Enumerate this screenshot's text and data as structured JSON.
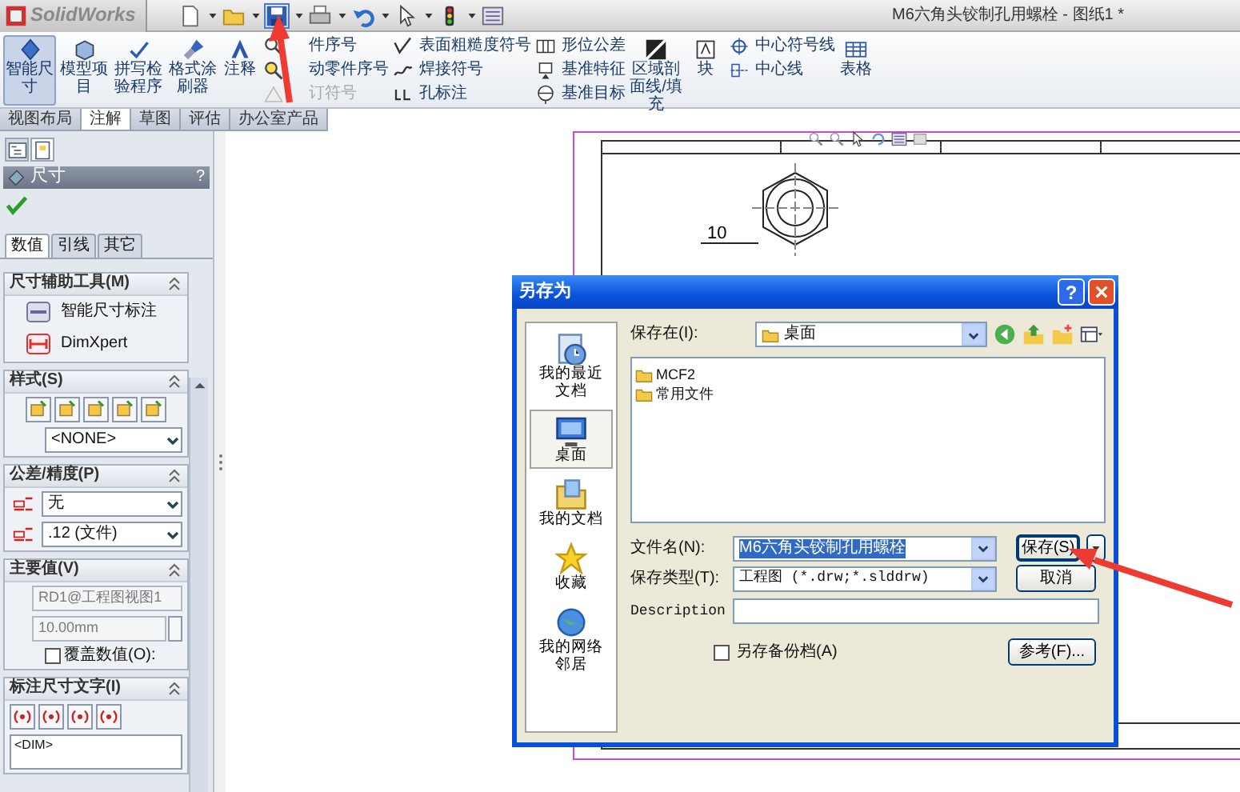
{
  "app": {
    "logo": "SolidWorks",
    "title": "M6六角头铰制孔用螺栓 - 图纸1 *"
  },
  "ribbon": [
    {
      "kind": "large",
      "label": "智能尺寸",
      "selected": true
    },
    {
      "kind": "large",
      "label": "模型项目",
      "selected": false
    },
    {
      "kind": "large",
      "label": "拼写检验程序",
      "selected": false
    },
    {
      "kind": "large",
      "label": "格式涂刷器",
      "selected": false
    },
    {
      "kind": "large",
      "label": "注释",
      "selected": false
    },
    {
      "kind": "stack",
      "items": [
        {
          "label": "件序号",
          "disabled": false
        },
        {
          "label": "动零件序号",
          "disabled": false
        },
        {
          "label": "订符号",
          "disabled": true
        }
      ]
    },
    {
      "kind": "stack",
      "items": [
        {
          "label": "表面粗糙度符号",
          "disabled": false
        },
        {
          "label": "焊接符号",
          "disabled": false
        },
        {
          "label": "孔标注",
          "disabled": false
        }
      ]
    },
    {
      "kind": "stack",
      "items": [
        {
          "label": "形位公差",
          "disabled": false
        },
        {
          "label": "基准特征",
          "disabled": false
        },
        {
          "label": "基准目标",
          "disabled": false
        }
      ]
    },
    {
      "kind": "large",
      "label": "区域剖面线/填充",
      "selected": false
    },
    {
      "kind": "large",
      "label": "块",
      "selected": false
    },
    {
      "kind": "stack",
      "items": [
        {
          "label": "中心符号线",
          "disabled": false
        },
        {
          "label": "中心线",
          "disabled": false
        }
      ]
    },
    {
      "kind": "large",
      "label": "表格",
      "selected": false
    }
  ],
  "command_tabs": [
    {
      "label": "视图布局",
      "selected": false
    },
    {
      "label": "注解",
      "selected": true
    },
    {
      "label": "草图",
      "selected": false
    },
    {
      "label": "评估",
      "selected": false
    },
    {
      "label": "办公室产品",
      "selected": false
    }
  ],
  "property_manager": {
    "tabs": [
      {
        "selected": false
      },
      {
        "selected": true
      }
    ],
    "title": "尺寸",
    "help": "?",
    "sub_tabs": [
      {
        "label": "数值",
        "selected": true
      },
      {
        "label": "引线",
        "selected": false
      },
      {
        "label": "其它",
        "selected": false
      }
    ],
    "sections": [
      {
        "title": "尺寸辅助工具(M)",
        "items": [
          {
            "kind": "tool",
            "label": "智能尺寸标注"
          },
          {
            "kind": "tool",
            "label": "DimXpert"
          }
        ]
      },
      {
        "title": "样式(S)",
        "items": [
          {
            "kind": "style_buttons"
          },
          {
            "kind": "select",
            "value": "<NONE>"
          }
        ]
      },
      {
        "title": "公差/精度(P)",
        "items": [
          {
            "kind": "select_icon",
            "value": "无"
          },
          {
            "kind": "select_icon",
            "value": ".12 (文件)"
          }
        ]
      },
      {
        "title": "主要值(V)",
        "items": [
          {
            "kind": "input",
            "value": "RD1@工程图视图1",
            "disabled": true
          },
          {
            "kind": "spinner",
            "value": "10.00mm",
            "disabled": true
          },
          {
            "kind": "checkbox",
            "label": "覆盖数值(O):",
            "checked": false
          }
        ]
      },
      {
        "title": "标注尺寸文字(I)",
        "items": [
          {
            "kind": "text_buttons"
          },
          {
            "kind": "textarea",
            "value": "<DIM>"
          }
        ]
      }
    ]
  },
  "drawing": {
    "dimension": "10"
  },
  "save_dialog": {
    "title": "另存为",
    "help": "?",
    "places": [
      {
        "label": "我的最近文档",
        "selected": false
      },
      {
        "label": "桌面",
        "selected": true
      },
      {
        "label": "我的文档",
        "selected": false
      },
      {
        "label": "收藏",
        "selected": false
      },
      {
        "label": "我的网络邻居",
        "selected": false
      }
    ],
    "save_in": {
      "label": "保存在(I):",
      "value": "桌面"
    },
    "files": [
      {
        "name": "MCF2"
      },
      {
        "name": "常用文件"
      }
    ],
    "file_name": {
      "label": "文件名(N):",
      "value": "M6六角头铰制孔用螺栓"
    },
    "file_type": {
      "label": "保存类型(T):",
      "value": "工程图 (*.drw;*.slddrw)"
    },
    "description": {
      "label": "Description"
    },
    "backup": {
      "label": "另存备份档(A)",
      "checked": false
    },
    "buttons": {
      "save": "保存(S)",
      "cancel": "取消",
      "references": "参考(F)..."
    }
  }
}
